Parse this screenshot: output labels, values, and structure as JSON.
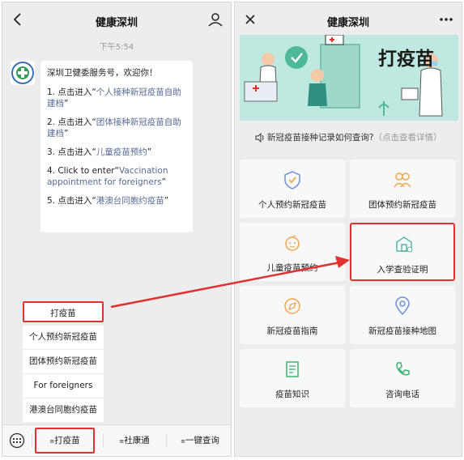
{
  "left": {
    "title": "健康深圳",
    "time": "下午5:54",
    "bubble": {
      "greeting": "深圳卫健委服务号，欢迎你！",
      "items": [
        {
          "prefix": "1. 点击进入“",
          "link": "个人接种新冠疫苗自助建档",
          "suffix": "”"
        },
        {
          "prefix": "2. 点击进入“",
          "link": "团体接种新冠疫苗自助建档",
          "suffix": "”"
        },
        {
          "prefix": "3. 点击进入“",
          "link": "儿童疫苗预约",
          "suffix": "”"
        },
        {
          "prefix": "4. Click to enter“",
          "link": "Vaccination appointment for foreigners",
          "suffix": "”"
        },
        {
          "prefix": "5. 点击进入“",
          "link": "港澳台同胞约疫苗",
          "suffix": "”"
        }
      ]
    },
    "submenu": [
      "打疫苗",
      "个人预约新冠疫苗",
      "团体预约新冠疫苗",
      "For foreigners",
      "港澳台同胞约疫苗"
    ],
    "bottom_tabs": [
      "打疫苗",
      "社康通",
      "一键查询"
    ]
  },
  "right": {
    "title": "健康深圳",
    "banner_title": "打疫苗",
    "notice": {
      "text": "新冠疫苗接种记录如何查询?",
      "hint": "（点击查看详情）"
    },
    "grid": [
      {
        "label": "个人预约新冠疫苗",
        "icon": "shield-icon"
      },
      {
        "label": "团体预约新冠疫苗",
        "icon": "group-icon"
      },
      {
        "label": "儿童疫苗预约",
        "icon": "child-icon"
      },
      {
        "label": "入学查验证明",
        "icon": "school-icon"
      },
      {
        "label": "新冠疫苗指南",
        "icon": "compass-icon"
      },
      {
        "label": "新冠疫苗接种地图",
        "icon": "map-pin-icon"
      },
      {
        "label": "疫苗知识",
        "icon": "book-icon"
      },
      {
        "label": "咨询电话",
        "icon": "phone-icon"
      }
    ]
  },
  "colors": {
    "accent_red": "#e03030",
    "link_blue": "#576b95",
    "icon_orange": "#f0a550",
    "icon_green": "#3cb371",
    "banner_teal": "#bfe9e0"
  }
}
